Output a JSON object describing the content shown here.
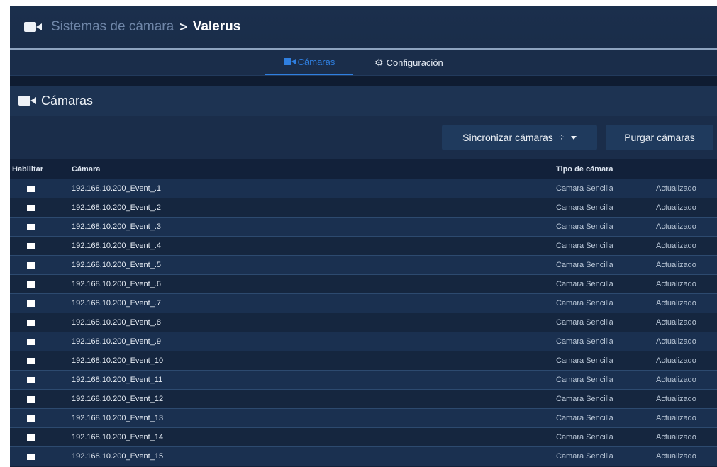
{
  "breadcrumb": {
    "root": "Sistemas de cámara",
    "separator": ">",
    "current": "Valerus"
  },
  "tabs": [
    {
      "label": "Cámaras",
      "icon": "camera-icon",
      "active": true
    },
    {
      "label": "Configuración",
      "icon": "gears-icon",
      "active": false
    }
  ],
  "panel": {
    "title": "Cámaras",
    "icon": "camera-icon"
  },
  "toolbar": {
    "sync_label": "Sincronizar cámaras",
    "purge_label": "Purgar cámaras"
  },
  "table": {
    "headers": {
      "enable": "Habilitar",
      "camera": "Cámara",
      "type": "Tipo de cámara",
      "status": ""
    },
    "rows": [
      {
        "name": "192.168.10.200_Event_.1",
        "type": "Camara Sencilla",
        "status": "Actualizado"
      },
      {
        "name": "192.168.10.200_Event_.2",
        "type": "Camara Sencilla",
        "status": "Actualizado"
      },
      {
        "name": "192.168.10.200_Event_.3",
        "type": "Camara Sencilla",
        "status": "Actualizado"
      },
      {
        "name": "192.168.10.200_Event_.4",
        "type": "Camara Sencilla",
        "status": "Actualizado"
      },
      {
        "name": "192.168.10.200_Event_.5",
        "type": "Camara Sencilla",
        "status": "Actualizado"
      },
      {
        "name": "192.168.10.200_Event_.6",
        "type": "Camara Sencilla",
        "status": "Actualizado"
      },
      {
        "name": "192.168.10.200_Event_.7",
        "type": "Camara Sencilla",
        "status": "Actualizado"
      },
      {
        "name": "192.168.10.200_Event_.8",
        "type": "Camara Sencilla",
        "status": "Actualizado"
      },
      {
        "name": "192.168.10.200_Event_.9",
        "type": "Camara Sencilla",
        "status": "Actualizado"
      },
      {
        "name": "192.168.10.200_Event_10",
        "type": "Camara Sencilla",
        "status": "Actualizado"
      },
      {
        "name": "192.168.10.200_Event_11",
        "type": "Camara Sencilla",
        "status": "Actualizado"
      },
      {
        "name": "192.168.10.200_Event_12",
        "type": "Camara Sencilla",
        "status": "Actualizado"
      },
      {
        "name": "192.168.10.200_Event_13",
        "type": "Camara Sencilla",
        "status": "Actualizado"
      },
      {
        "name": "192.168.10.200_Event_14",
        "type": "Camara Sencilla",
        "status": "Actualizado"
      },
      {
        "name": "192.168.10.200_Event_15",
        "type": "Camara Sencilla",
        "status": "Actualizado"
      }
    ]
  },
  "colors": {
    "background": "#12213a",
    "header": "#1b2f4c",
    "accent": "#2f7fe0",
    "row_odd": "#1a3050",
    "row_even": "#15263f"
  }
}
